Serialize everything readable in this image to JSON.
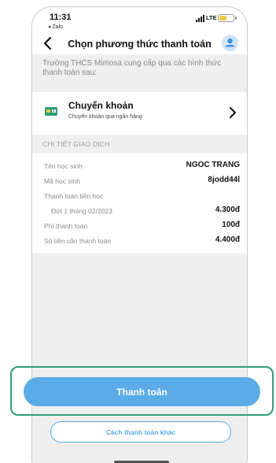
{
  "status_bar": {
    "time": "11:31",
    "back_app": "◂ Zalo",
    "network": "LTE"
  },
  "header": {
    "title": "Chọn phương thức thanh toán"
  },
  "intro_text": "Trường THCS Mimosa cung cấp qua các hình thức thanh toán sau:",
  "payment_method": {
    "title": "Chuyển khoản",
    "subtitle": "Chuyển khoản qua ngân hàng"
  },
  "transaction": {
    "section_title": "CHI TIẾT GIAO DỊCH",
    "rows": [
      {
        "label": "Tên học sinh",
        "value": "NGOC TRANG"
      },
      {
        "label": "Mã học sinh",
        "value": "8jodd44l"
      },
      {
        "label": "Thanh toán tiền học",
        "value": ""
      },
      {
        "label": "Đợt 1 tháng 02/2023",
        "value": "4.300đ"
      },
      {
        "label": "Phí thanh toán",
        "value": "100đ"
      },
      {
        "label": "Số tiền cần thanh toán",
        "value": "4.400đ"
      }
    ]
  },
  "actions": {
    "pay_label": "Thanh toán",
    "other_label": "Cách thanh toán khác"
  },
  "colors": {
    "accent": "#5aabe6",
    "highlight": "#2f9e77",
    "background": "#efefef"
  }
}
